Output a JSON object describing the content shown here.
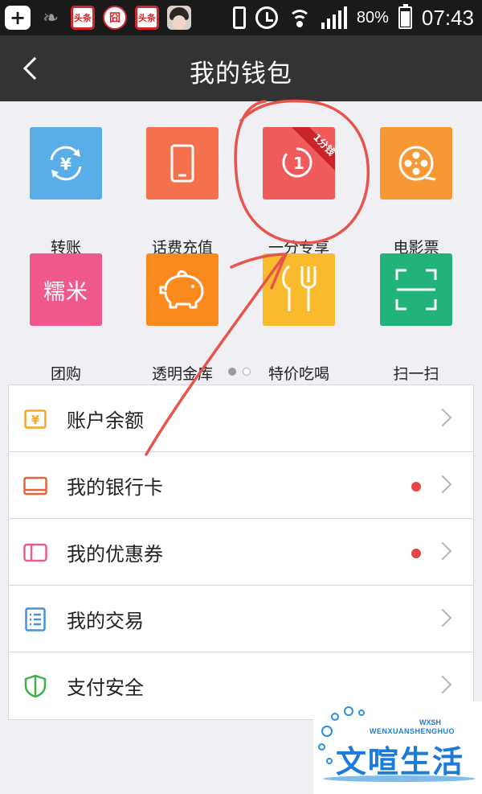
{
  "status_bar": {
    "left_icons": [
      "add-box-icon",
      "leaf-icon",
      "toutiao-app-icon",
      "seal-app-icon",
      "toutiao-app-icon",
      "avatar-app-icon"
    ],
    "toutiao_text": "头条",
    "seal_text": "囧",
    "battery_percent": "80%",
    "time": "07:43"
  },
  "header": {
    "title": "我的钱包"
  },
  "grid": {
    "items": [
      {
        "label": "转账",
        "color": "#5aaee8",
        "icon": "transfer-yuan-icon"
      },
      {
        "label": "话费充值",
        "color": "#f5714e",
        "icon": "phone-recharge-icon"
      },
      {
        "label": "一分专享",
        "color": "#ef5a5a",
        "icon": "one-cent-icon",
        "ribbon": "1分钱",
        "badge_number": "1"
      },
      {
        "label": "电影票",
        "color": "#f79834",
        "icon": "film-reel-icon"
      },
      {
        "label": "团购",
        "color": "#f0578b",
        "icon": "nuomi-icon",
        "icon_text": "糯米"
      },
      {
        "label": "透明金库",
        "color": "#fb8a1e",
        "icon": "piggy-bank-icon"
      },
      {
        "label": "特价吃喝",
        "color": "#f9bb2d",
        "icon": "fork-knife-icon"
      },
      {
        "label": "扫一扫",
        "color": "#21b37a",
        "icon": "scan-icon"
      }
    ],
    "page_indicator": {
      "pages": 2,
      "current": 1
    }
  },
  "list": {
    "items": [
      {
        "label": "账户余额",
        "icon": "balance-yuan-icon",
        "color": "#f5a623",
        "dot": false
      },
      {
        "label": "我的银行卡",
        "icon": "bank-card-icon",
        "color": "#e8643c",
        "dot": true
      },
      {
        "label": "我的优惠券",
        "icon": "coupon-icon",
        "color": "#ef5a8c",
        "dot": true
      },
      {
        "label": "我的交易",
        "icon": "transactions-list-icon",
        "color": "#4a90d9",
        "dot": false
      },
      {
        "label": "支付安全",
        "icon": "shield-icon",
        "color": "#3eb049",
        "dot": false
      }
    ],
    "dot_color": "#e44545"
  },
  "annotation": {
    "color": "#e8544c"
  },
  "watermark": {
    "chinese": "文喧生活",
    "english": "WENXUANSHENGHUO",
    "abbr": "WXSH"
  }
}
